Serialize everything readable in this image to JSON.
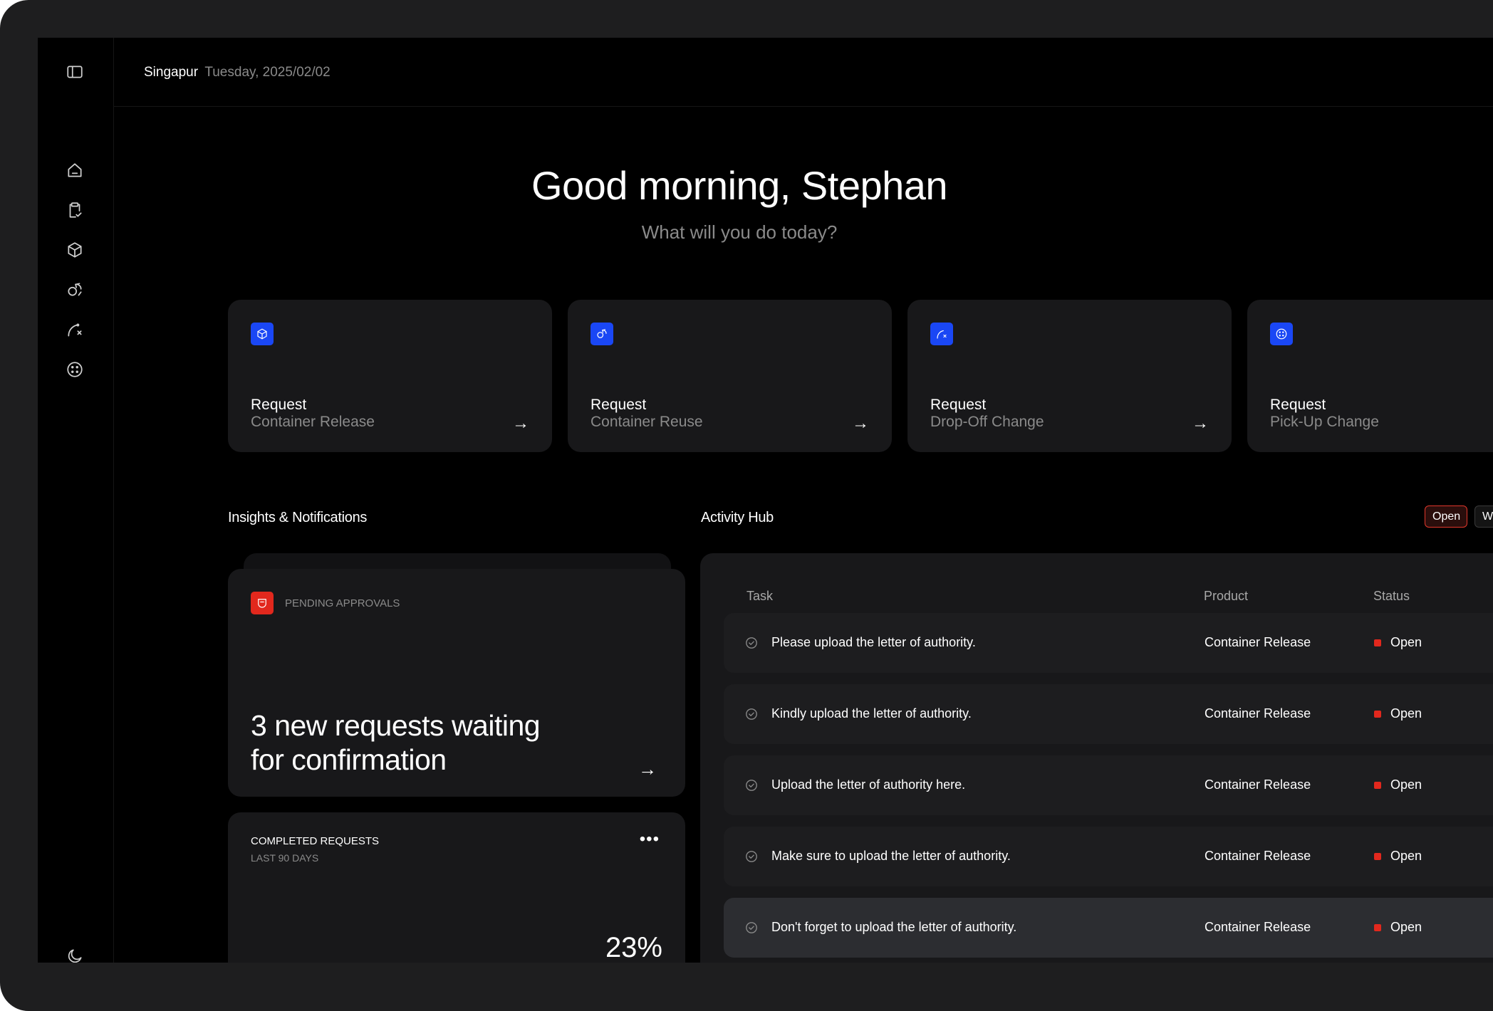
{
  "topbar": {
    "location": "Singapur",
    "date": "Tuesday, 2025/02/02"
  },
  "hero": {
    "greeting": "Good morning, Stephan",
    "subtitle": "What will you do today?"
  },
  "sidebar": {
    "items": [
      {
        "icon": "sidebar-toggle-icon"
      },
      {
        "icon": "home-icon"
      },
      {
        "icon": "clipboard-check-icon"
      },
      {
        "icon": "box-icon"
      },
      {
        "icon": "reuse-icon"
      },
      {
        "icon": "route-icon"
      },
      {
        "icon": "dotted-circle-icon"
      },
      {
        "icon": "moon-icon"
      }
    ]
  },
  "actions": [
    {
      "title": "Request",
      "subtitle": "Container Release",
      "icon": "box-icon",
      "arrow": "→"
    },
    {
      "title": "Request",
      "subtitle": "Container Reuse",
      "icon": "reuse-icon",
      "arrow": "→"
    },
    {
      "title": "Request",
      "subtitle": "Drop-Off Change",
      "icon": "route-icon",
      "arrow": "→"
    },
    {
      "title": "Request",
      "subtitle": "Pick-Up Change",
      "icon": "dotted-circle-icon",
      "arrow": "→"
    }
  ],
  "insights": {
    "title": "Insights & Notifications",
    "pending": {
      "label": "PENDING APPROVALS",
      "message": "3 new requests waiting for confirmation",
      "arrow": "→"
    },
    "completed": {
      "label": "COMPLETED REQUESTS",
      "sublabel": "LAST 90 DAYS",
      "more": "•••",
      "percent": "23%"
    }
  },
  "activity": {
    "title": "Activity Hub",
    "filters": [
      "Open",
      "Wa"
    ],
    "columns": {
      "task": "Task",
      "product": "Product",
      "status": "Status"
    },
    "rows": [
      {
        "task": "Please upload the letter of authority.",
        "product": "Container Release",
        "status": "Open"
      },
      {
        "task": "Kindly upload the letter of authority.",
        "product": "Container Release",
        "status": "Open"
      },
      {
        "task": "Upload the letter of authority here.",
        "product": "Container Release",
        "status": "Open"
      },
      {
        "task": "Make sure to upload the letter of authority.",
        "product": "Container Release",
        "status": "Open"
      },
      {
        "task": "Don't forget to upload the letter of authority.",
        "product": "Container Release",
        "status": "Open"
      }
    ]
  },
  "colors": {
    "accent_blue": "#1a47f5",
    "alert_red": "#e2281d",
    "card_bg": "#18181a",
    "screen_bg": "#000000"
  }
}
